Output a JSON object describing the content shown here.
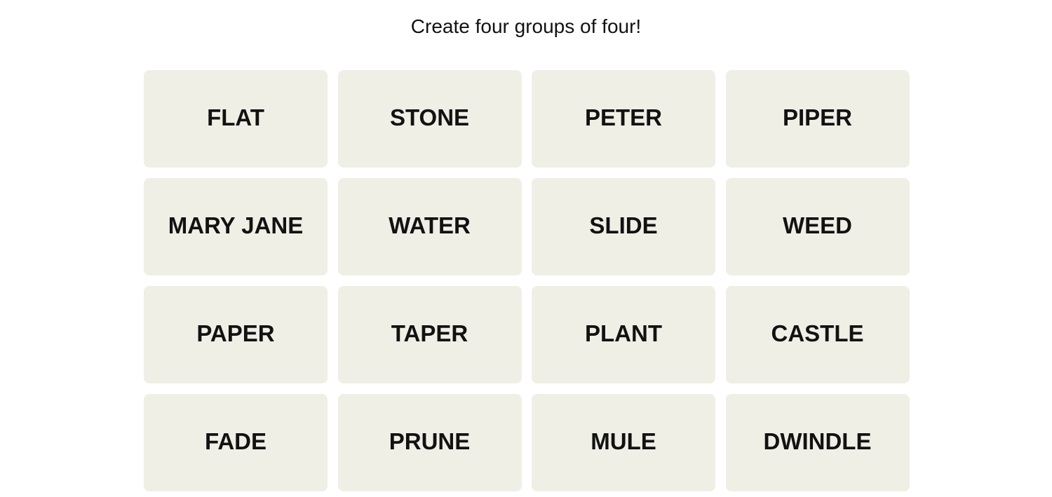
{
  "prompt": "Create four groups of four!",
  "tiles": [
    "FLAT",
    "STONE",
    "PETER",
    "PIPER",
    "MARY JANE",
    "WATER",
    "SLIDE",
    "WEED",
    "PAPER",
    "TAPER",
    "PLANT",
    "CASTLE",
    "FADE",
    "PRUNE",
    "MULE",
    "DWINDLE"
  ],
  "colors": {
    "tile_background": "#efefe6",
    "text": "#121212"
  }
}
